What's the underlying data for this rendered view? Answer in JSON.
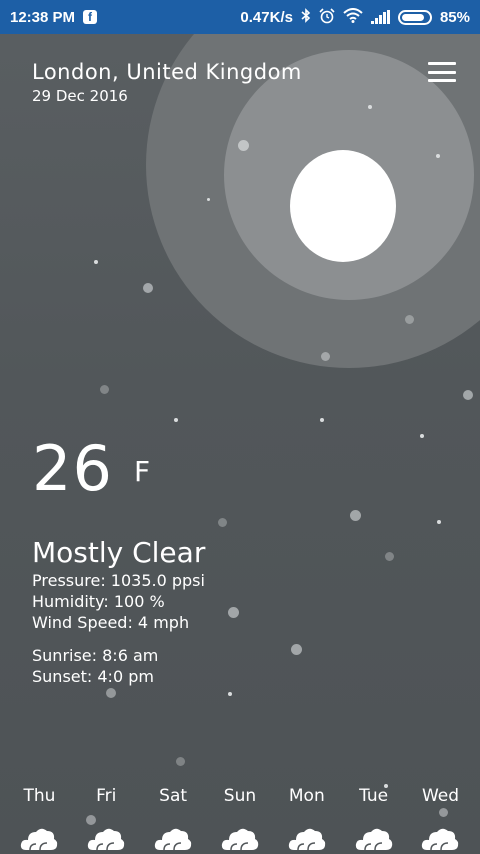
{
  "status_bar": {
    "time": "12:38 PM",
    "notification_icon": "facebook-icon",
    "network_speed": "0.47K/s",
    "battery_percent": "85%",
    "battery_level": 0.85,
    "icons": [
      "bluetooth-icon",
      "alarm-icon",
      "wifi-icon",
      "signal-icon",
      "battery-icon"
    ]
  },
  "header": {
    "location": "London, United Kingdom",
    "date": "29 Dec 2016",
    "menu_icon": "hamburger-menu-icon"
  },
  "current": {
    "temperature": "26",
    "unit": "F",
    "condition": "Mostly Clear",
    "pressure": "Pressure: 1035.0 ppsi",
    "humidity": "Humidity: 100 %",
    "wind": "Wind Speed: 4 mph",
    "sunrise": "Sunrise: 8:6 am",
    "sunset": "Sunset: 4:0 pm"
  },
  "forecast": [
    {
      "day": "Thu",
      "icon": "cloud-icon"
    },
    {
      "day": "Fri",
      "icon": "cloud-icon"
    },
    {
      "day": "Sat",
      "icon": "cloud-icon"
    },
    {
      "day": "Sun",
      "icon": "cloud-icon"
    },
    {
      "day": "Mon",
      "icon": "cloud-icon"
    },
    {
      "day": "Tue",
      "icon": "cloud-icon"
    },
    {
      "day": "Wed",
      "icon": "cloud-icon"
    }
  ],
  "colors": {
    "status_bar": "#1d5fa6",
    "background": "#52575a",
    "moon": "#ffffff"
  }
}
